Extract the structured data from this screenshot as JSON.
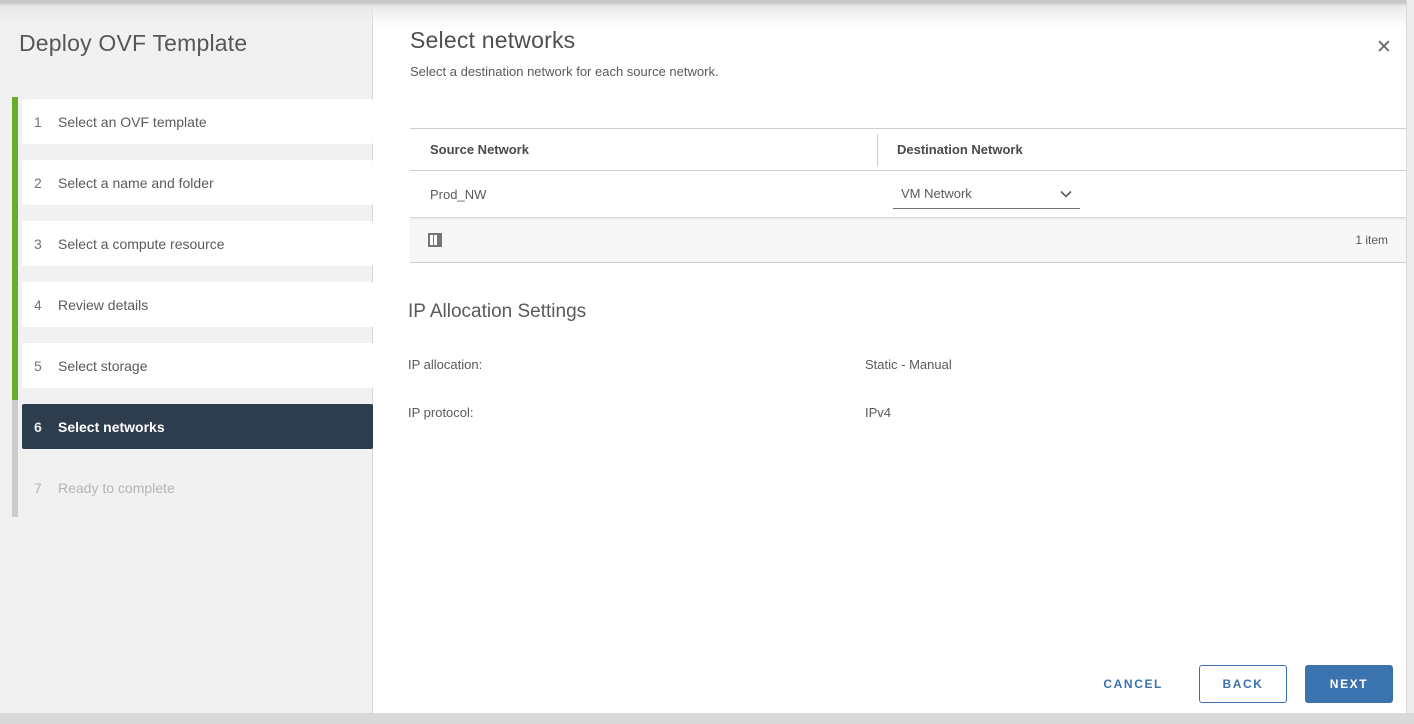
{
  "wizard": {
    "title": "Deploy OVF Template",
    "steps": [
      {
        "num": "1",
        "label": "Select an OVF template"
      },
      {
        "num": "2",
        "label": "Select a name and folder"
      },
      {
        "num": "3",
        "label": "Select a compute resource"
      },
      {
        "num": "4",
        "label": "Review details"
      },
      {
        "num": "5",
        "label": "Select storage"
      },
      {
        "num": "6",
        "label": "Select networks"
      },
      {
        "num": "7",
        "label": "Ready to complete"
      }
    ]
  },
  "page": {
    "title": "Select networks",
    "subtitle": "Select a destination network for each source network."
  },
  "icons": {
    "close": "✕"
  },
  "table": {
    "columns": [
      "Source Network",
      "Destination Network"
    ],
    "rows": [
      {
        "source": "Prod_NW",
        "destination": "VM Network"
      }
    ],
    "footer": {
      "items_label": "1 item"
    }
  },
  "ip_settings": {
    "heading": "IP Allocation Settings",
    "fields": [
      {
        "label": "IP allocation:",
        "value": "Static - Manual"
      },
      {
        "label": "IP protocol:",
        "value": "IPv4"
      }
    ]
  },
  "buttons": {
    "cancel": "CANCEL",
    "back": "BACK",
    "next": "NEXT"
  },
  "colors": {
    "accent_blue": "#3b73af",
    "progress_green": "#65ae2d",
    "active_step_bg": "#2e3d4d",
    "inactive_bar_gray": "#cccccc"
  }
}
